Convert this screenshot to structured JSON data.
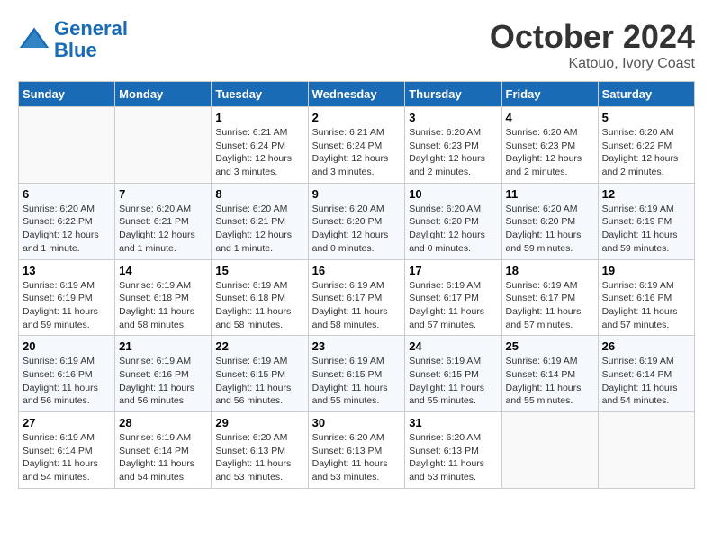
{
  "header": {
    "logo_line1": "General",
    "logo_line2": "Blue",
    "month": "October 2024",
    "location": "Katouo, Ivory Coast"
  },
  "weekdays": [
    "Sunday",
    "Monday",
    "Tuesday",
    "Wednesday",
    "Thursday",
    "Friday",
    "Saturday"
  ],
  "weeks": [
    [
      {
        "day": "",
        "info": ""
      },
      {
        "day": "",
        "info": ""
      },
      {
        "day": "1",
        "info": "Sunrise: 6:21 AM\nSunset: 6:24 PM\nDaylight: 12 hours and 3 minutes."
      },
      {
        "day": "2",
        "info": "Sunrise: 6:21 AM\nSunset: 6:24 PM\nDaylight: 12 hours and 3 minutes."
      },
      {
        "day": "3",
        "info": "Sunrise: 6:20 AM\nSunset: 6:23 PM\nDaylight: 12 hours and 2 minutes."
      },
      {
        "day": "4",
        "info": "Sunrise: 6:20 AM\nSunset: 6:23 PM\nDaylight: 12 hours and 2 minutes."
      },
      {
        "day": "5",
        "info": "Sunrise: 6:20 AM\nSunset: 6:22 PM\nDaylight: 12 hours and 2 minutes."
      }
    ],
    [
      {
        "day": "6",
        "info": "Sunrise: 6:20 AM\nSunset: 6:22 PM\nDaylight: 12 hours and 1 minute."
      },
      {
        "day": "7",
        "info": "Sunrise: 6:20 AM\nSunset: 6:21 PM\nDaylight: 12 hours and 1 minute."
      },
      {
        "day": "8",
        "info": "Sunrise: 6:20 AM\nSunset: 6:21 PM\nDaylight: 12 hours and 1 minute."
      },
      {
        "day": "9",
        "info": "Sunrise: 6:20 AM\nSunset: 6:20 PM\nDaylight: 12 hours and 0 minutes."
      },
      {
        "day": "10",
        "info": "Sunrise: 6:20 AM\nSunset: 6:20 PM\nDaylight: 12 hours and 0 minutes."
      },
      {
        "day": "11",
        "info": "Sunrise: 6:20 AM\nSunset: 6:20 PM\nDaylight: 11 hours and 59 minutes."
      },
      {
        "day": "12",
        "info": "Sunrise: 6:19 AM\nSunset: 6:19 PM\nDaylight: 11 hours and 59 minutes."
      }
    ],
    [
      {
        "day": "13",
        "info": "Sunrise: 6:19 AM\nSunset: 6:19 PM\nDaylight: 11 hours and 59 minutes."
      },
      {
        "day": "14",
        "info": "Sunrise: 6:19 AM\nSunset: 6:18 PM\nDaylight: 11 hours and 58 minutes."
      },
      {
        "day": "15",
        "info": "Sunrise: 6:19 AM\nSunset: 6:18 PM\nDaylight: 11 hours and 58 minutes."
      },
      {
        "day": "16",
        "info": "Sunrise: 6:19 AM\nSunset: 6:17 PM\nDaylight: 11 hours and 58 minutes."
      },
      {
        "day": "17",
        "info": "Sunrise: 6:19 AM\nSunset: 6:17 PM\nDaylight: 11 hours and 57 minutes."
      },
      {
        "day": "18",
        "info": "Sunrise: 6:19 AM\nSunset: 6:17 PM\nDaylight: 11 hours and 57 minutes."
      },
      {
        "day": "19",
        "info": "Sunrise: 6:19 AM\nSunset: 6:16 PM\nDaylight: 11 hours and 57 minutes."
      }
    ],
    [
      {
        "day": "20",
        "info": "Sunrise: 6:19 AM\nSunset: 6:16 PM\nDaylight: 11 hours and 56 minutes."
      },
      {
        "day": "21",
        "info": "Sunrise: 6:19 AM\nSunset: 6:16 PM\nDaylight: 11 hours and 56 minutes."
      },
      {
        "day": "22",
        "info": "Sunrise: 6:19 AM\nSunset: 6:15 PM\nDaylight: 11 hours and 56 minutes."
      },
      {
        "day": "23",
        "info": "Sunrise: 6:19 AM\nSunset: 6:15 PM\nDaylight: 11 hours and 55 minutes."
      },
      {
        "day": "24",
        "info": "Sunrise: 6:19 AM\nSunset: 6:15 PM\nDaylight: 11 hours and 55 minutes."
      },
      {
        "day": "25",
        "info": "Sunrise: 6:19 AM\nSunset: 6:14 PM\nDaylight: 11 hours and 55 minutes."
      },
      {
        "day": "26",
        "info": "Sunrise: 6:19 AM\nSunset: 6:14 PM\nDaylight: 11 hours and 54 minutes."
      }
    ],
    [
      {
        "day": "27",
        "info": "Sunrise: 6:19 AM\nSunset: 6:14 PM\nDaylight: 11 hours and 54 minutes."
      },
      {
        "day": "28",
        "info": "Sunrise: 6:19 AM\nSunset: 6:14 PM\nDaylight: 11 hours and 54 minutes."
      },
      {
        "day": "29",
        "info": "Sunrise: 6:20 AM\nSunset: 6:13 PM\nDaylight: 11 hours and 53 minutes."
      },
      {
        "day": "30",
        "info": "Sunrise: 6:20 AM\nSunset: 6:13 PM\nDaylight: 11 hours and 53 minutes."
      },
      {
        "day": "31",
        "info": "Sunrise: 6:20 AM\nSunset: 6:13 PM\nDaylight: 11 hours and 53 minutes."
      },
      {
        "day": "",
        "info": ""
      },
      {
        "day": "",
        "info": ""
      }
    ]
  ]
}
